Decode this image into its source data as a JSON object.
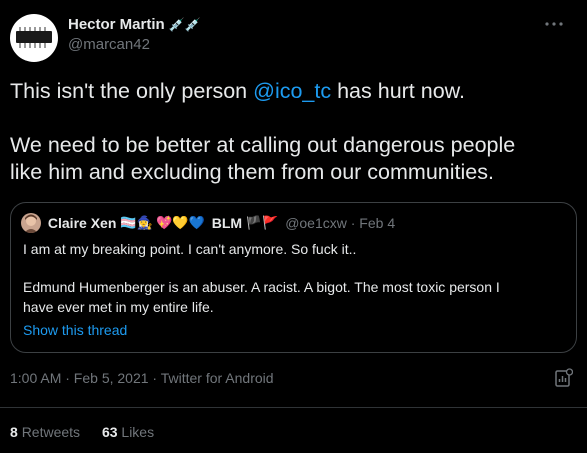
{
  "author": {
    "name": "Hector Martin",
    "name_emoji": "💉💉",
    "handle": "@marcan42"
  },
  "tweet": {
    "line1_before": "This isn't the only person ",
    "mention": "@ico_tc",
    "line1_after": " has hurt now.",
    "line2": "We need to be better at calling out dangerous people",
    "line3": "like him and excluding them from our communities."
  },
  "quote": {
    "name": "Claire Xen",
    "name_emoji": "🏳️‍⚧️🧙‍♀️ 💖💛💙",
    "badge": "BLM",
    "flags": "🏴🚩",
    "handle_date": "@oe1cxw · Feb 4",
    "line1": "I am at my breaking point. I can't anymore. So fuck it..",
    "line2": "Edmund Humenberger is an abuser. A racist. A bigot. The most toxic person I",
    "line3": "have ever met in my entire life.",
    "show_thread": "Show this thread"
  },
  "meta": {
    "timestamp": "1:00 AM · Feb 5, 2021 · Twitter for Android"
  },
  "stats": {
    "retweets_count": "8",
    "retweets_label": "Retweets",
    "likes_count": "63",
    "likes_label": "Likes"
  },
  "icons": {
    "more": "more-icon",
    "analytics": "analytics-icon"
  },
  "colors": {
    "background": "#000000",
    "text": "#e7e9ea",
    "secondary": "#71767b",
    "link": "#1d9bf0",
    "border": "#2f3336"
  }
}
